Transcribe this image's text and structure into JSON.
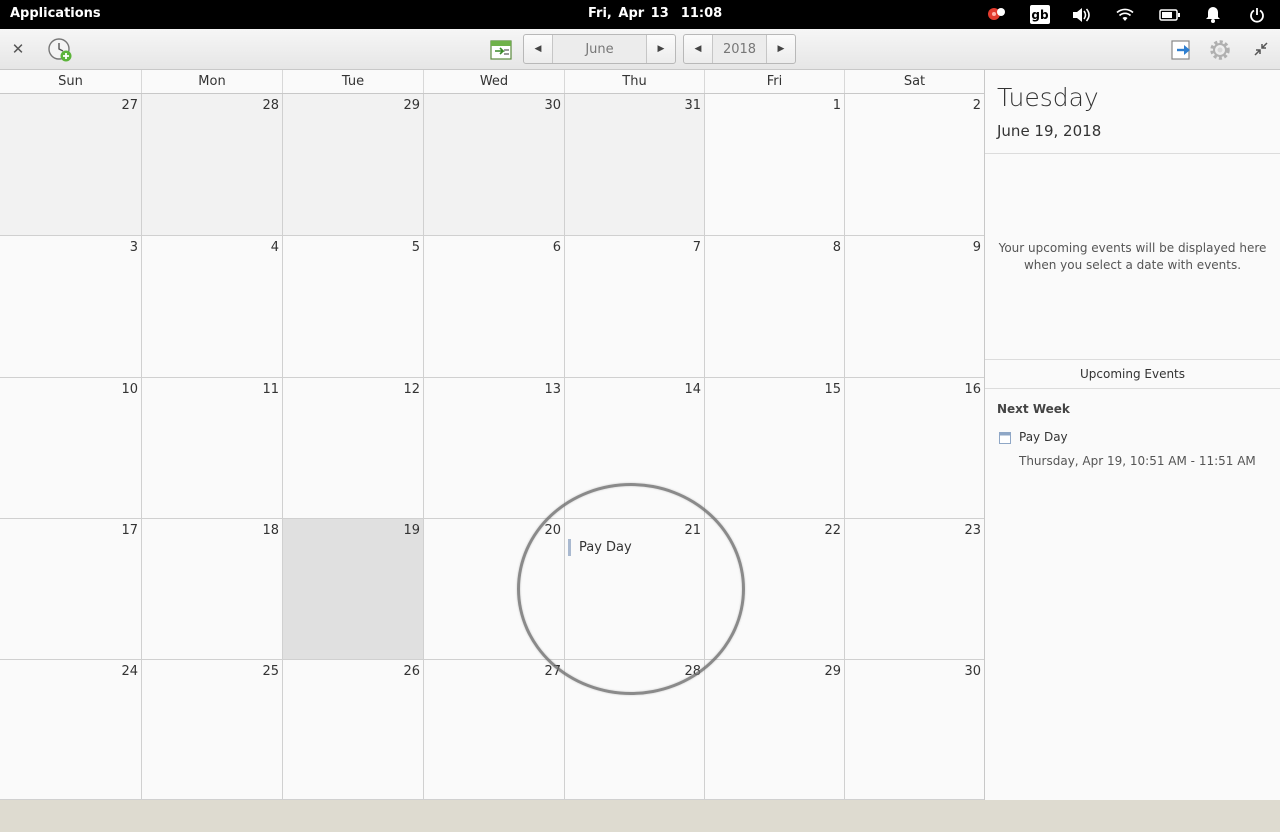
{
  "panel": {
    "applications_label": "Applications",
    "date": "Fri, Apr 13",
    "time": "11:08",
    "keyboard_layout": "gb"
  },
  "headerbar": {
    "month": "June",
    "year": "2018"
  },
  "weekdays": [
    "Sun",
    "Mon",
    "Tue",
    "Wed",
    "Thu",
    "Fri",
    "Sat"
  ],
  "weeks": [
    [
      {
        "d": "27",
        "other": true
      },
      {
        "d": "28",
        "other": true
      },
      {
        "d": "29",
        "other": true
      },
      {
        "d": "30",
        "other": true
      },
      {
        "d": "31",
        "other": true
      },
      {
        "d": "1"
      },
      {
        "d": "2"
      }
    ],
    [
      {
        "d": "3"
      },
      {
        "d": "4"
      },
      {
        "d": "5"
      },
      {
        "d": "6"
      },
      {
        "d": "7"
      },
      {
        "d": "8"
      },
      {
        "d": "9"
      }
    ],
    [
      {
        "d": "10"
      },
      {
        "d": "11"
      },
      {
        "d": "12"
      },
      {
        "d": "13"
      },
      {
        "d": "14"
      },
      {
        "d": "15"
      },
      {
        "d": "16"
      }
    ],
    [
      {
        "d": "17"
      },
      {
        "d": "18"
      },
      {
        "d": "19",
        "selected": true
      },
      {
        "d": "20"
      },
      {
        "d": "21",
        "event": "Pay Day"
      },
      {
        "d": "22"
      },
      {
        "d": "23"
      }
    ],
    [
      {
        "d": "24"
      },
      {
        "d": "25"
      },
      {
        "d": "26"
      },
      {
        "d": "27"
      },
      {
        "d": "28"
      },
      {
        "d": "29"
      },
      {
        "d": "30"
      }
    ]
  ],
  "sidebar": {
    "weekday": "Tuesday",
    "date": "June 19, 2018",
    "empty_text": "Your upcoming events will be displayed here when you select a date with events.",
    "upcoming_title": "Upcoming Events",
    "section": "Next Week",
    "event_name": "Pay Day",
    "event_time": "Thursday, Apr 19, 10:51 AM - 11:51 AM"
  },
  "colors": {
    "event_bar": "#a9b9d0",
    "selected_day": "#e0e0e0",
    "other_month": "#f2f2f2"
  }
}
